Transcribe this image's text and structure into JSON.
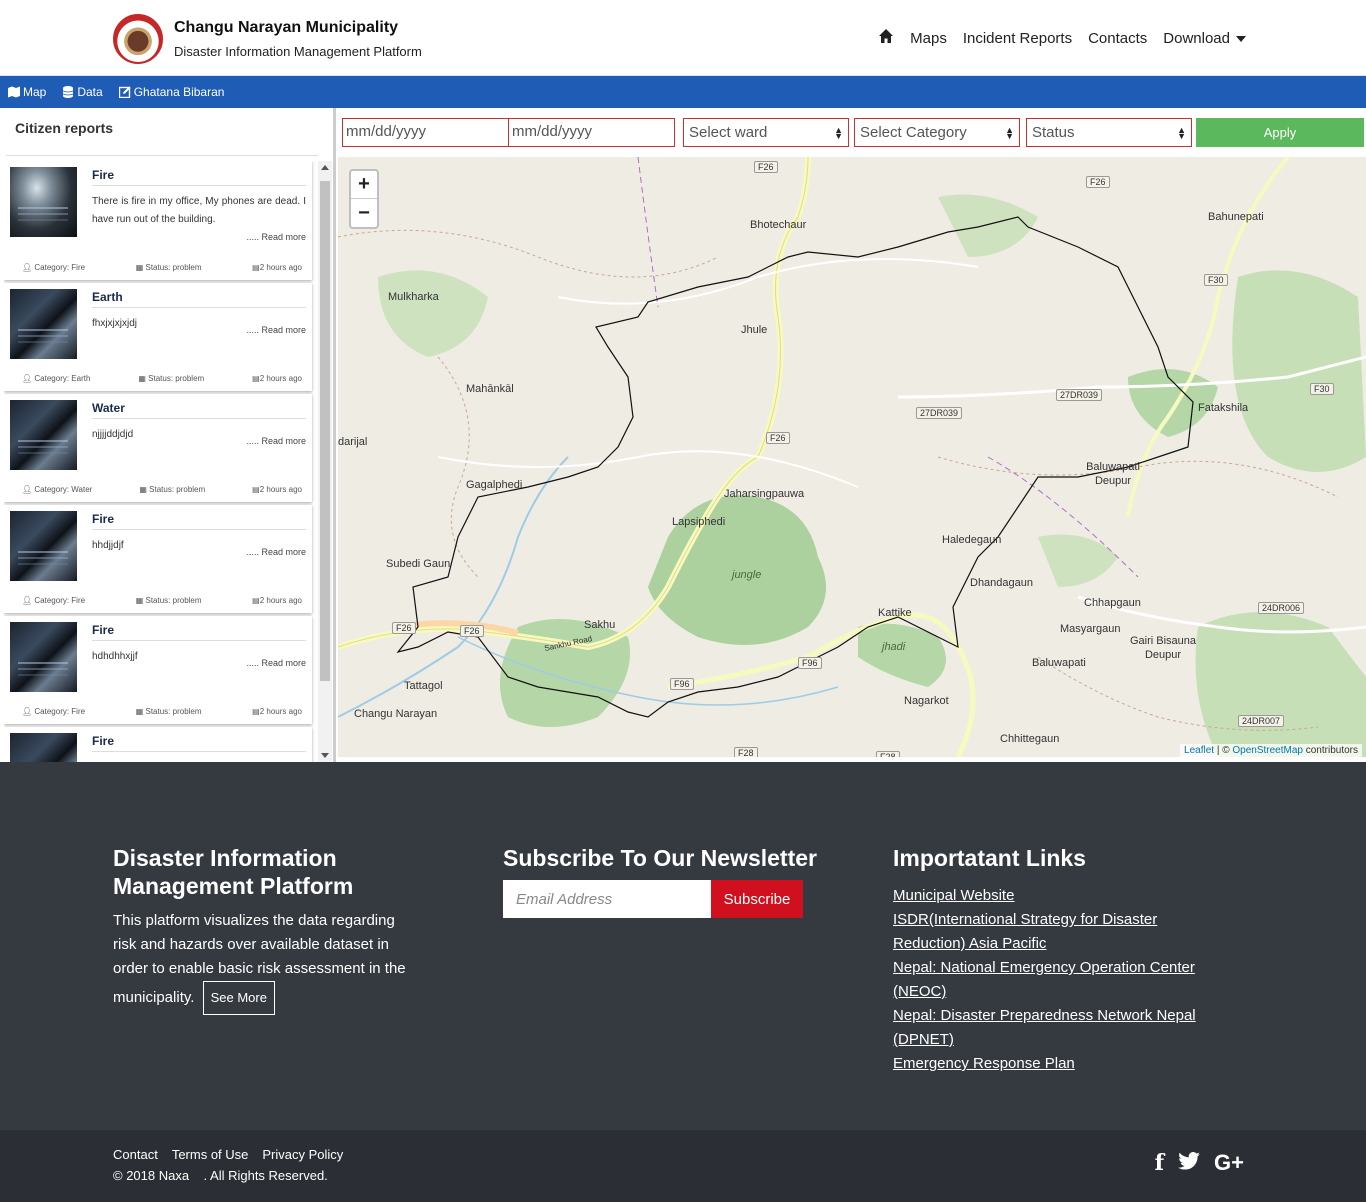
{
  "header": {
    "title": "Changu Narayan Municipality",
    "subtitle": "Disaster Information Management Platform",
    "nav": {
      "maps": "Maps",
      "incident_reports": "Incident Reports",
      "contacts": "Contacts",
      "download": "Download"
    }
  },
  "toolbar": {
    "map": "Map",
    "data": "Data",
    "ghatana": "Ghatana Bibaran"
  },
  "sidebar": {
    "title": "Citizen reports",
    "read_more": "..... Read more",
    "reports": [
      {
        "title": "Fire",
        "desc": "There is fire in my office, My phones are dead. I have run out of the building.",
        "category": "Category: Fire",
        "status": "Status: problem",
        "time": "2 hours ago"
      },
      {
        "title": "Earth",
        "desc": "fhxjxjxjxjdj",
        "category": "Category: Earth",
        "status": "Status: problem",
        "time": "2 hours ago"
      },
      {
        "title": "Water",
        "desc": "njjjjddjdjd",
        "category": "Category: Water",
        "status": "Status: problem",
        "time": "2 hours ago"
      },
      {
        "title": "Fire",
        "desc": "hhdjjdjf",
        "category": "Category: Fire",
        "status": "Status: problem",
        "time": "2 hours ago"
      },
      {
        "title": "Fire",
        "desc": "hdhdhhxjjf",
        "category": "Category: Fire",
        "status": "Status: problem",
        "time": "2 hours ago"
      },
      {
        "title": "Fire",
        "desc": "",
        "category": "",
        "status": "",
        "time": ""
      }
    ]
  },
  "filters": {
    "date_from_placeholder": "mm/dd/yyyy",
    "date_to_placeholder": "mm/dd/yyyy",
    "ward": "Select ward",
    "category": "Select Category",
    "status": "Status",
    "apply": "Apply"
  },
  "map": {
    "zoom_in": "+",
    "zoom_out": "−",
    "attribution_leaflet": "Leaflet",
    "attribution_sep": " | © ",
    "attribution_osm": "OpenStreetMap",
    "attribution_tail": " contributors",
    "places": [
      "Bhotechaur",
      "Bahunepati",
      "Mulkharka",
      "Jhule",
      "Mahānkāl",
      "Fatakshila",
      "darijal",
      "Baluwapati Deupur",
      "Gagalphedi",
      "Jaharsingpauwa",
      "Lapsiphedi",
      "Haledegaun",
      "Subedi Gaun",
      "jungle",
      "Dhandagaun",
      "Chhapgaun",
      "Kattike",
      "Sakhu",
      "Masyargaun",
      "Gairi Bisauna Deupur",
      "Baluwapati",
      "Tattagol",
      "Nagarkot",
      "Changu Narayan",
      "Chhittegaun",
      "Sankhu Road",
      "jhadi"
    ],
    "roads": [
      "F26",
      "F26",
      "F30",
      "F30",
      "27DR039",
      "27DR039",
      "F26",
      "24DR006",
      "F26",
      "F26",
      "F96",
      "F96",
      "24DR007",
      "F28",
      "F28"
    ]
  },
  "footer": {
    "about_heading": "Disaster Information Management Platform",
    "about_text": "This platform visualizes the data regarding risk and hazards over available dataset in order to enable basic risk assessment in the municipality.",
    "see_more": "See More",
    "newsletter_heading": "Subscribe To Our Newsletter",
    "email_placeholder": "Email Address",
    "subscribe": "Subscribe",
    "links_heading": "Importatant Links",
    "links": [
      "Municipal Website",
      "ISDR(International Strategy for Disaster Reduction) Asia Pacific",
      "Nepal: National Emergency Operation Center (NEOC)",
      "Nepal: Disaster Preparedness Network Nepal (DPNET)",
      "Emergency Response Plan"
    ],
    "bottom_links": {
      "contact": "Contact",
      "terms": "Terms of Use",
      "privacy": "Privacy Policy"
    },
    "copyright": "© 2018 Naxa    . All Rights Reserved."
  },
  "colors": {
    "toolbar_blue": "#1f5cb5",
    "apply_green": "#5cb85c",
    "subscribe_red": "#d0101e",
    "footer_bg": "#353940",
    "input_border": "#c9302c"
  },
  "icons": [
    "home-icon",
    "map-icon",
    "database-icon",
    "edit-icon",
    "user-icon",
    "calendar-icon",
    "facebook-icon",
    "twitter-icon",
    "google-plus-icon"
  ]
}
